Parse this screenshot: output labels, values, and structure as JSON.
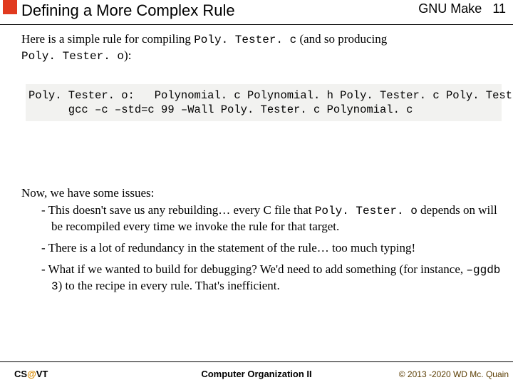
{
  "header": {
    "title": "Defining a More Complex Rule",
    "topic": "GNU Make",
    "page": "11"
  },
  "intro": {
    "p1a": "Here is a simple rule for compiling ",
    "p1b": "Poly. Tester. c",
    "p1c": " (and so producing ",
    "p1d": "Poly. Tester. o",
    "p1e": "):"
  },
  "code": {
    "line1": "Poly. Tester. o:   Polynomial. c Polynomial. h Poly. Tester. c Poly. Tester. h",
    "line2": "      gcc –c –std=c 99 –Wall Poly. Tester. c Polynomial. c"
  },
  "issues": {
    "lead": "Now, we have some issues:",
    "li1a": "This doesn't save us any rebuilding… every C file that ",
    "li1b": "Poly. Tester. o",
    "li1c": " depends on will be recompiled every time we invoke the rule for that target.",
    "li2": "There is a lot of redundancy in the statement of the rule… too much typing!",
    "li3a": "What if we wanted to build for debugging?  We'd need to add something (for instance, ",
    "li3b": "–ggdb 3",
    "li3c": ") to the recipe in every rule.  That's inefficient."
  },
  "footer": {
    "left_cs": "CS",
    "left_at": "@",
    "left_vt": "VT",
    "center": "Computer Organization II",
    "right": "© 2013 -2020 WD Mc. Quain"
  }
}
